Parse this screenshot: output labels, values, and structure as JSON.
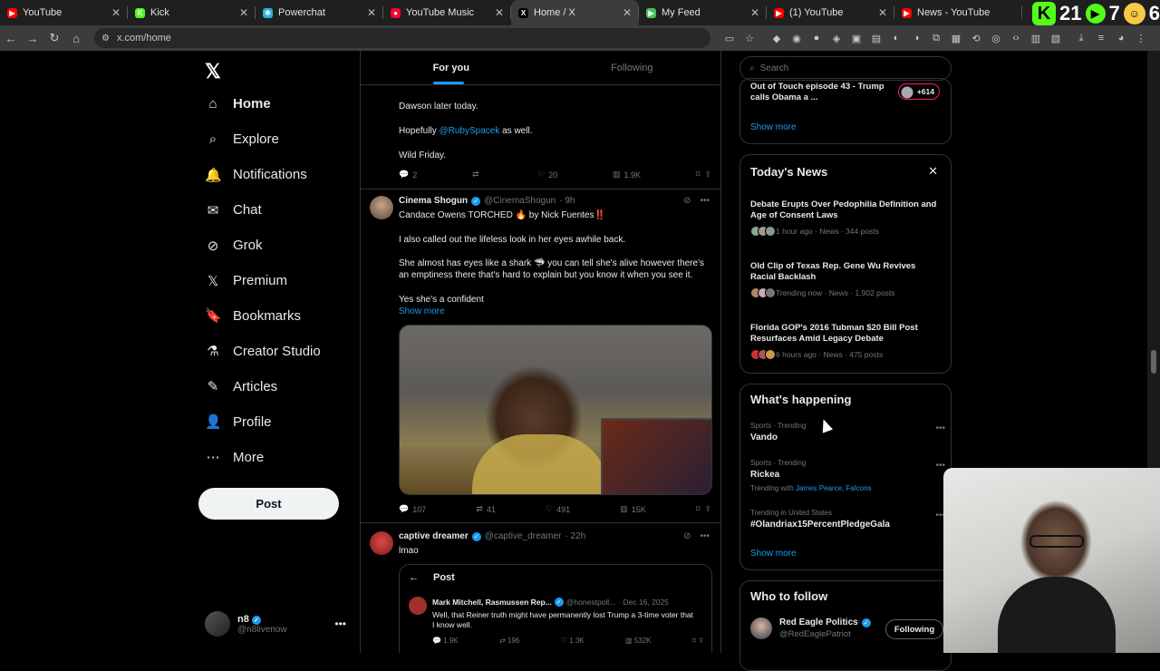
{
  "browser": {
    "tabs": [
      {
        "label": "YouTube",
        "fav_color": "#ff0000",
        "fav": "▶"
      },
      {
        "label": "Kick",
        "fav_color": "#53fc18",
        "fav": "K"
      },
      {
        "label": "Powerchat",
        "fav_color": "#2bb1d9",
        "fav": "✲"
      },
      {
        "label": "YouTube Music",
        "fav_color": "#ff0033",
        "fav": "●"
      },
      {
        "label": "Home / X",
        "fav_color": "#000000",
        "fav": "X"
      },
      {
        "label": "My Feed",
        "fav_color": "#46c35b",
        "fav": "▶"
      },
      {
        "label": "(1) YouTube",
        "fav_color": "#ff0000",
        "fav": "▶"
      },
      {
        "label": "News - YouTube",
        "fav_color": "#ff0000",
        "fav": "▶"
      }
    ],
    "url": "x.com/home",
    "overlay": {
      "kick_count": "21",
      "rumble_count": "7",
      "other_count": "6"
    }
  },
  "sidebar": {
    "items": [
      {
        "label": "Home",
        "icon": "home-icon"
      },
      {
        "label": "Explore",
        "icon": "search-icon"
      },
      {
        "label": "Notifications",
        "icon": "bell-icon"
      },
      {
        "label": "Chat",
        "icon": "mail-icon"
      },
      {
        "label": "Grok",
        "icon": "grok-icon"
      },
      {
        "label": "Premium",
        "icon": "x-icon"
      },
      {
        "label": "Bookmarks",
        "icon": "bookmark-icon"
      },
      {
        "label": "Creator Studio",
        "icon": "flask-icon"
      },
      {
        "label": "Articles",
        "icon": "article-icon"
      },
      {
        "label": "Profile",
        "icon": "person-icon"
      },
      {
        "label": "More",
        "icon": "more-circle-icon"
      }
    ],
    "post_label": "Post",
    "account": {
      "name": "n8",
      "handle": "@n8livenow"
    }
  },
  "feed": {
    "tabs": [
      "For you",
      "Following"
    ],
    "post0": {
      "lines": [
        "Dawson later today.",
        "Hopefully",
        "@RubySpacek",
        "as well.",
        "Wild Friday."
      ],
      "replies": "2",
      "reposts": "",
      "likes": "20",
      "views": "1.9K"
    },
    "post1": {
      "name": "Cinema Shogun",
      "handle": "@CinemaShogun",
      "time": "· 9h",
      "line1": "Candace Owens TORCHED 🔥 by Nick Fuentes‼️",
      "line2": "I also called out the lifeless look in her eyes awhile back.",
      "line3": "She almost has eyes like a shark 🦈 you can tell she's alive however there's an emptiness there that's hard to explain but you know it when you see it.",
      "line4": "Yes she's a confident",
      "show_more": "Show more",
      "replies": "107",
      "reposts": "41",
      "likes": "491",
      "views": "15K"
    },
    "post2": {
      "name": "captive dreamer",
      "handle": "@captive_dreamer",
      "time": "· 22h",
      "text": "lmao",
      "quote_header": "Post",
      "quote_name": "Mark Mitchell, Rasmussen Rep...",
      "quote_handle": "@honestpoll...",
      "quote_time": "· Dec 16, 2025",
      "quote_text": "Well, that Reiner truth might have permanently lost Trump a 3-time voter that I know well.",
      "q_replies": "1.9K",
      "q_reposts": "196",
      "q_likes": "1.3K",
      "q_views": "532K"
    }
  },
  "right": {
    "search_placeholder": "Search",
    "top_card": {
      "title": "Out of Touch episode 43 - Trump calls Obama a ...",
      "badge": "+614",
      "show_more": "Show more"
    },
    "todays_news": {
      "title": "Today's News",
      "items": [
        {
          "title": "Debate Erupts Over Pedophilia Definition and Age of Consent Laws",
          "meta": "1 hour ago · News · 344 posts"
        },
        {
          "title": "Old Clip of Texas Rep. Gene Wu Revives Racial Backlash",
          "meta": "Trending now · News · 1,902 posts"
        },
        {
          "title": "Florida GOP's 2016 Tubman $20 Bill Post Resurfaces Amid Legacy Debate",
          "meta": "6 hours ago · News · 475 posts"
        }
      ]
    },
    "whats_happening": {
      "title": "What's happening",
      "items": [
        {
          "context": "Sports · Trending",
          "name": "Vando",
          "with": ""
        },
        {
          "context": "Sports · Trending",
          "name": "Rickea",
          "with_prefix": "Trending with",
          "with": "James Pearce, Falcons"
        },
        {
          "context": "Trending in United States",
          "name": "#Olandriax15PercentPledgeGala",
          "with": ""
        }
      ],
      "show_more": "Show more"
    },
    "who_to_follow": {
      "title": "Who to follow",
      "name": "Red Eagle Politics",
      "handle": "@RedEaglePatriot",
      "button": "Following"
    }
  }
}
